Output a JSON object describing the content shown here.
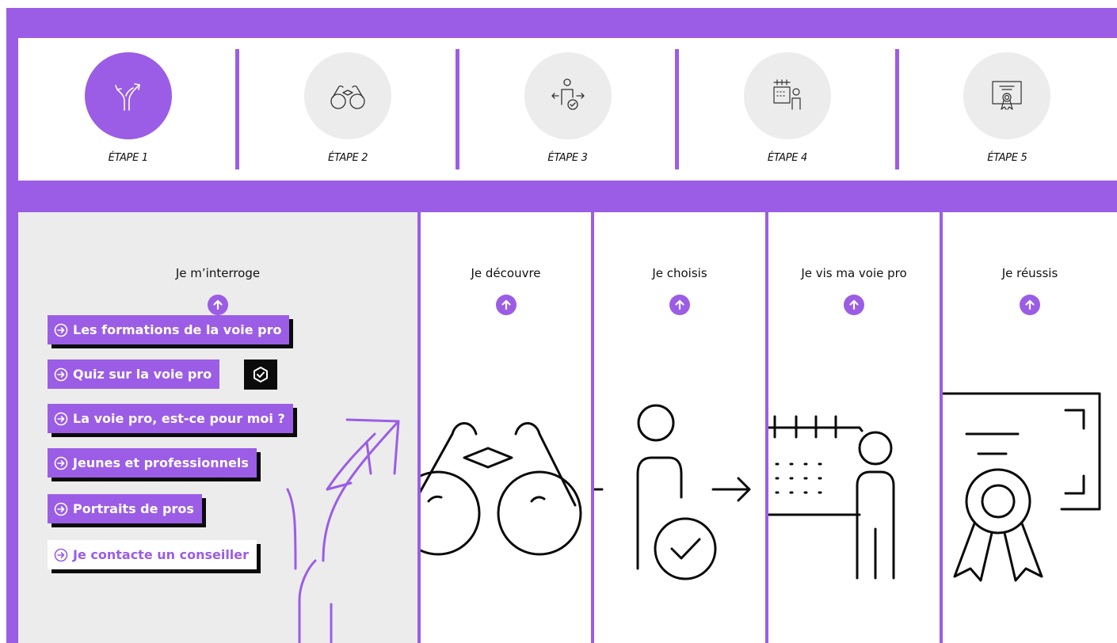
{
  "colors": {
    "accent": "#9b5de5",
    "panel_grey": "#ececec",
    "shadow": "#0b0b0b"
  },
  "steps": [
    {
      "label": "ÉTAPE 1",
      "icon": "crossroads-arrows-icon",
      "active": true
    },
    {
      "label": "ÉTAPE 2",
      "icon": "binoculars-icon",
      "active": false
    },
    {
      "label": "ÉTAPE 3",
      "icon": "person-choice-icon",
      "active": false
    },
    {
      "label": "ÉTAPE 4",
      "icon": "calendar-person-icon",
      "active": false
    },
    {
      "label": "ÉTAPE 5",
      "icon": "certificate-icon",
      "active": false
    }
  ],
  "panels": [
    {
      "title": "Je m’interroge",
      "up_icon": "arrow-up-circle-icon",
      "illustration": "crossroads-arrows-icon"
    },
    {
      "title": "Je découvre",
      "up_icon": "arrow-up-circle-icon",
      "illustration": "binoculars-icon"
    },
    {
      "title": "Je choisis",
      "up_icon": "arrow-up-circle-icon",
      "illustration": "person-choice-icon"
    },
    {
      "title": "Je vis ma voie pro",
      "up_icon": "arrow-up-circle-icon",
      "illustration": "calendar-person-icon"
    },
    {
      "title": "Je réussis",
      "up_icon": "arrow-up-circle-icon",
      "illustration": "certificate-icon"
    }
  ],
  "menu": [
    {
      "label": "Les formations de la voie pro"
    },
    {
      "label": "Quiz sur la voie pro",
      "badge_icon": "shield-check-icon"
    },
    {
      "label": "La voie pro, est-ce pour moi ?"
    },
    {
      "label": "Jeunes et professionnels"
    },
    {
      "label": "Portraits de pros"
    },
    {
      "label": "Je contacte un conseiller"
    }
  ]
}
